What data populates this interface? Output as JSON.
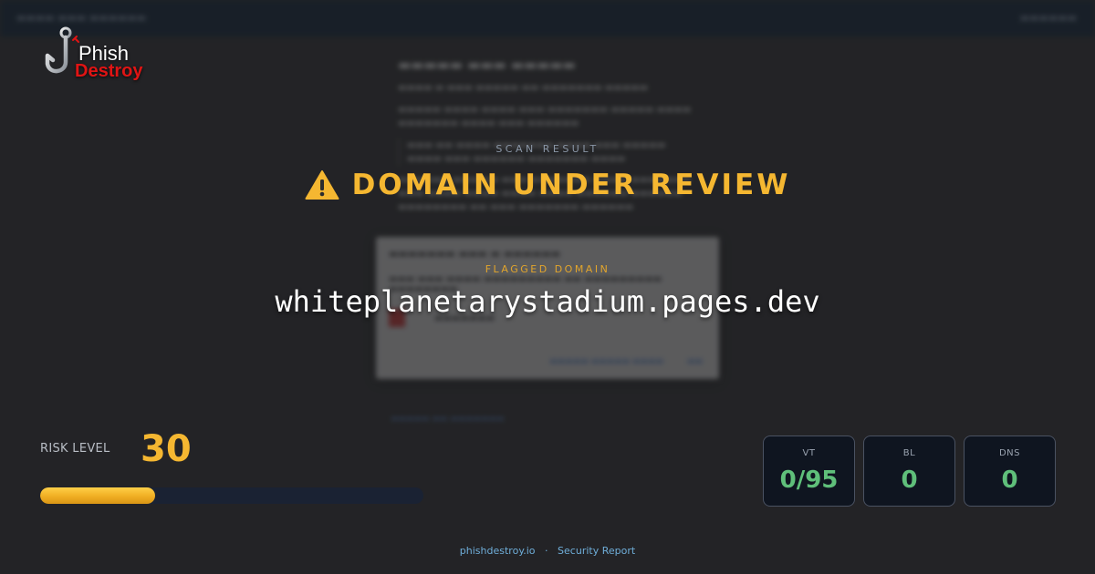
{
  "logo": {
    "line1": "Phish",
    "line2": "Destroy"
  },
  "headline": {
    "scan_label": "SCAN RESULT",
    "status": "DOMAIN UNDER REVIEW",
    "icon": "warning-triangle-icon"
  },
  "flagged": {
    "label": "FLAGGED DOMAIN",
    "domain": "whiteplanetarystadium.pages.dev"
  },
  "risk": {
    "label": "RISK LEVEL",
    "value": "30",
    "level_fraction": 0.3
  },
  "stats": [
    {
      "label": "VT",
      "value": "0/95"
    },
    {
      "label": "BL",
      "value": "0"
    },
    {
      "label": "DNS",
      "value": "0"
    }
  ],
  "footer": {
    "site": "phishdestroy.io",
    "separator": "·",
    "report": "Security Report"
  },
  "colors": {
    "accent_amber": "#f5b731",
    "danger_red": "#e01414",
    "ok_green": "#5fbf7a",
    "link_blue": "#6faed9"
  }
}
